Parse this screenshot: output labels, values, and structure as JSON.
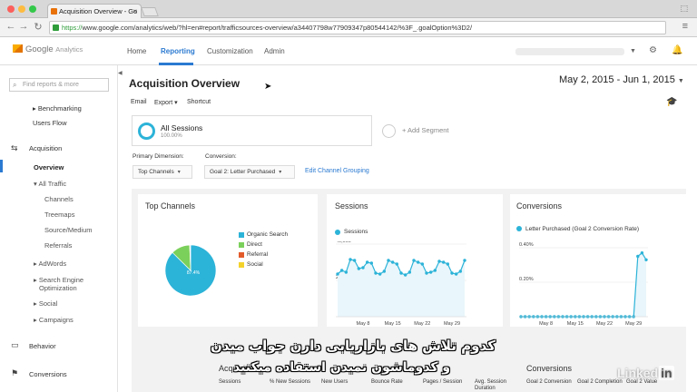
{
  "browser": {
    "tab_title": "Acquisition Overview - Go",
    "url_scheme": "https://",
    "url_rest": "www.google.com/analytics/web/?hl=en#report/trafficsources-overview/a34407798w77909347p80544142/%3F_.goalOption%3D2/"
  },
  "header": {
    "logo_google": "Google",
    "logo_analytics": "Analytics",
    "nav": [
      "Home",
      "Reporting",
      "Customization",
      "Admin"
    ]
  },
  "sidebar": {
    "search_placeholder": "Find reports & more",
    "benchmarking": "Benchmarking",
    "users_flow": "Users Flow",
    "acquisition": "Acquisition",
    "overview": "Overview",
    "all_traffic": "All Traffic",
    "channels": "Channels",
    "treemaps": "Treemaps",
    "source_medium": "Source/Medium",
    "referrals": "Referrals",
    "adwords": "AdWords",
    "seo_1": "Search Engine",
    "seo_2": "Optimization",
    "social": "Social",
    "campaigns": "Campaigns",
    "behavior": "Behavior",
    "conversions": "Conversions"
  },
  "main": {
    "title": "Acquisition Overview",
    "date_range": "May 2, 2015 - Jun 1, 2015",
    "toolbar": [
      "Email",
      "Export",
      "Shortcut"
    ],
    "segment_name": "All Sessions",
    "segment_pct": "100.00%",
    "add_segment": "+ Add Segment",
    "primary_dimension_label": "Primary Dimension:",
    "conversion_label": "Conversion:",
    "primary_dimension_value": "Top Channels",
    "conversion_value": "Goal 2: Letter Purchased",
    "edit_channel_grouping": "Edit Channel Grouping"
  },
  "panels": {
    "top_channels": "Top Channels",
    "sessions": "Sessions",
    "conversions": "Conversions"
  },
  "chart_data": [
    {
      "type": "pie",
      "title": "Top Channels",
      "categories": [
        "Organic Search",
        "Direct",
        "Referral",
        "Social"
      ],
      "values": [
        87.4,
        12.0,
        0.4,
        0.2
      ],
      "slice_label": "87.4%",
      "colors": [
        "#2cb3d8",
        "#7bd05b",
        "#e25b2b",
        "#f4d22c"
      ],
      "legend_placement": "right"
    },
    {
      "type": "line",
      "title": "Sessions",
      "series": [
        {
          "name": "Sessions",
          "values": [
            23500,
            25500,
            24500,
            31500,
            31000,
            26500,
            27000,
            30000,
            29500,
            24000,
            23500,
            25000,
            31000,
            30000,
            29000,
            24000,
            23000,
            24500,
            31000,
            30000,
            29000,
            24000,
            24500,
            25500,
            30500,
            30000,
            29000,
            24000,
            23500,
            25000,
            31000
          ]
        }
      ],
      "yticks": [
        "40,000",
        "20,000"
      ],
      "ylim": [
        0,
        40000
      ],
      "xticks": [
        "May 8",
        "May 15",
        "May 22",
        "May 29"
      ],
      "color": "#2cb3d8"
    },
    {
      "type": "line",
      "title": "Conversions",
      "series": [
        {
          "name": "Letter Purchased (Goal 2 Conversion Rate)",
          "values": [
            0.0001,
            0.0001,
            0.0001,
            0.0001,
            0.0001,
            0.0001,
            0.0001,
            0.0001,
            0.0001,
            0.0001,
            0.0001,
            0.0001,
            0.0001,
            0.0001,
            0.0001,
            0.0001,
            0.0001,
            0.0001,
            0.0001,
            0.0001,
            0.0001,
            0.0001,
            0.0001,
            0.0001,
            0.0001,
            0.0001,
            0.0001,
            0.0001,
            0.35,
            0.37,
            0.33
          ]
        }
      ],
      "yticks": [
        "0.40%",
        "0.20%"
      ],
      "ylim": [
        0,
        0.4
      ],
      "xticks": [
        "May 8",
        "May 15",
        "May 22",
        "May 29"
      ],
      "color": "#2cb3d8"
    }
  ],
  "subtitles": {
    "line1": "کدوم تلاش های بازاریابی دارن جواب میدن",
    "line2": "و کدوماشون نمیدن استفاده میکنید"
  },
  "bottom": {
    "acquisition": "Acquisition",
    "conversions": "Conversions",
    "columns": [
      "Sessions",
      "% New Sessions",
      "New Users",
      "Bounce Rate",
      "Pages / Session",
      "Avg. Session Duration",
      "Goal 2 Conversion",
      "Goal 2 Completion",
      "Goal 2 Value"
    ]
  },
  "watermark": {
    "brand": "Linked",
    "in": "in"
  }
}
